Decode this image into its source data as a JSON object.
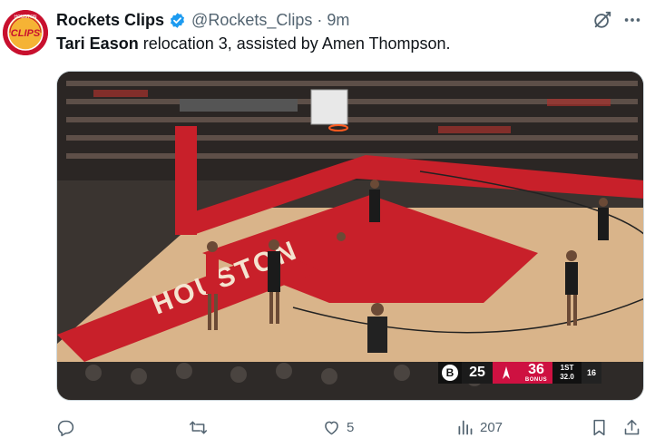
{
  "author": {
    "display_name": "Rockets Clips",
    "handle": "@Rockets_Clips",
    "separator": "·",
    "time": "9m",
    "avatar_text": "CLIPS",
    "avatar_ring_text": "HOUSTON"
  },
  "tweet": {
    "mention": "Tari Eason",
    "text": " relocation 3, assisted by Amen Thompson."
  },
  "video": {
    "court_text": "HOUSTON",
    "scorebug": {
      "away_logo": "B",
      "away_score": "25",
      "home_score": "36",
      "home_bonus": "BONUS",
      "period": "1ST",
      "clock": "32.0",
      "shot_clock": "16"
    }
  },
  "actions": {
    "reply_count": "",
    "retweet_count": "",
    "like_count": "5",
    "views_count": "207"
  },
  "colors": {
    "accent": "#1d9bf0",
    "muted": "#536471",
    "rockets_red": "#ce1141"
  },
  "icons": [
    "verified-badge-icon",
    "grok-icon",
    "more-icon",
    "reply-icon",
    "retweet-icon",
    "like-icon",
    "views-icon",
    "bookmark-icon",
    "share-icon"
  ]
}
